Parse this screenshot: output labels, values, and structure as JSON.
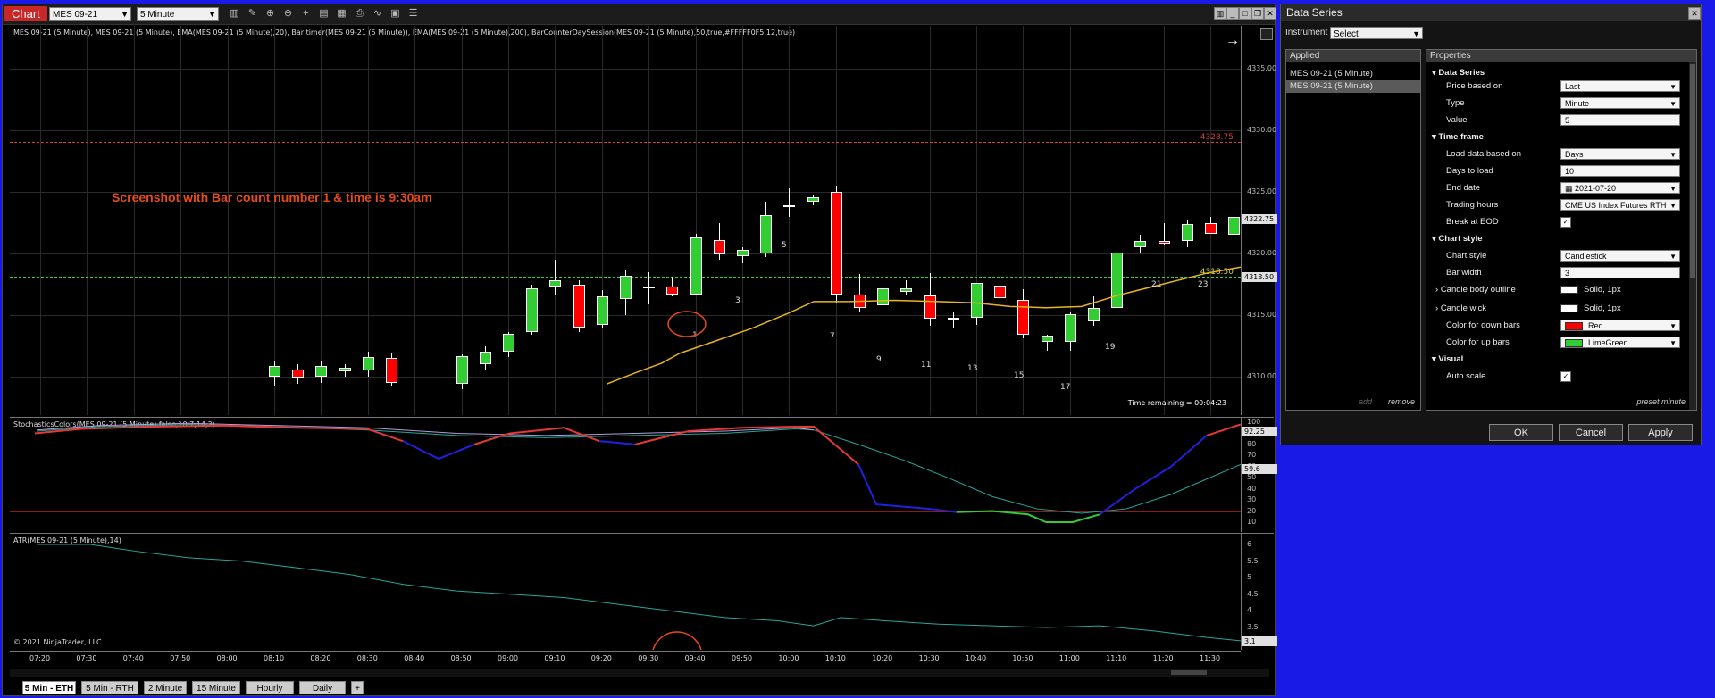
{
  "chart": {
    "tab": "Chart",
    "instrument": "MES 09-21",
    "interval": "5 Minute",
    "indicators_label": "MES 09-21 (5 Minute), MES 09-21 (5 Minute), EMA(MES 09-21 (5 Minute),20), Bar timer(MES 09-21 (5 Minute)), EMA(MES 09-21 (5 Minute),200), BarCounterDaySession(MES 09-21 (5 Minute),50,true,#FFFFF0F5,12,true)",
    "annotation": "Screenshot with Bar count number 1 & time is 9:30am",
    "time_remaining": "Time remaining = 00:04:23",
    "price_ticks": [
      "4335.00",
      "4330.00",
      "4325.00",
      "4320.00",
      "4315.00",
      "4310.00"
    ],
    "line_red_label": "4328.75",
    "line_green_label": "4318.50",
    "last_price_tag": "4322.75",
    "green_line_tag": "4318.50",
    "bar_numbers": [
      "1",
      "3",
      "5",
      "7",
      "9",
      "11",
      "13",
      "15",
      "17",
      "19",
      "21",
      "23"
    ],
    "copyright": "© 2021 NinjaTrader, LLC",
    "time_axis": [
      "07:20",
      "07:30",
      "07:40",
      "07:50",
      "08:00",
      "08:10",
      "08:20",
      "08:30",
      "08:40",
      "08:50",
      "09:00",
      "09:10",
      "09:20",
      "09:30",
      "09:40",
      "09:50",
      "10:00",
      "10:10",
      "10:20",
      "10:30",
      "10:40",
      "10:50",
      "11:00",
      "11:10",
      "11:20",
      "11:30"
    ]
  },
  "stochastics": {
    "label": "StochasticsColors(MES 09-21 (5 Minute),false,10,7,14,3)",
    "ticks": [
      "100",
      "90",
      "80",
      "70",
      "60",
      "50",
      "40",
      "30",
      "20",
      "10"
    ],
    "tag": "92.25",
    "tag2": "59.6"
  },
  "atr": {
    "label": "ATR(MES 09-21 (5 Minute),14)",
    "ticks": [
      "6",
      "5.5",
      "5",
      "4.5",
      "4",
      "3.5"
    ],
    "tag": "3.1"
  },
  "bottom_tabs": [
    "5 Min - ETH",
    "5 Min - RTH",
    "2 Minute",
    "15 Minute",
    "Hourly",
    "Daily",
    "+"
  ],
  "dialog": {
    "title": "Data Series",
    "instrument_label": "Instrument",
    "instrument_value": "Select",
    "applied_header": "Applied",
    "applied_items": [
      "MES 09-21 (5 Minute)",
      "MES 09-21 (5 Minute)"
    ],
    "add_label": "add",
    "remove_label": "remove",
    "properties_header": "Properties",
    "sections": {
      "data_series": "Data Series",
      "time_frame": "Time frame",
      "chart_style": "Chart style",
      "visual": "Visual"
    },
    "props": {
      "price_based_on": {
        "label": "Price based on",
        "value": "Last"
      },
      "type": {
        "label": "Type",
        "value": "Minute"
      },
      "value": {
        "label": "Value",
        "value": "5"
      },
      "load_data_based_on": {
        "label": "Load data based on",
        "value": "Days"
      },
      "days_to_load": {
        "label": "Days to load",
        "value": "10"
      },
      "end_date": {
        "label": "End date",
        "value": "2021-07-20"
      },
      "trading_hours": {
        "label": "Trading hours",
        "value": "CME US Index Futures RTH"
      },
      "break_at_eod": {
        "label": "Break at EOD",
        "value": "✓"
      },
      "chart_style": {
        "label": "Chart style",
        "value": "Candlestick"
      },
      "bar_width": {
        "label": "Bar width",
        "value": "3"
      },
      "candle_body_outline": {
        "label": "Candle body outline",
        "value": "Solid, 1px"
      },
      "candle_wick": {
        "label": "Candle wick",
        "value": "Solid, 1px"
      },
      "color_down": {
        "label": "Color for down bars",
        "value": "Red"
      },
      "color_up": {
        "label": "Color for up bars",
        "value": "LimeGreen"
      },
      "auto_scale": {
        "label": "Auto scale",
        "value": "✓"
      }
    },
    "preset_label": "preset minute",
    "ok": "OK",
    "cancel": "Cancel",
    "apply": "Apply"
  },
  "colors": {
    "up": "#32cd32",
    "down": "#ff0000",
    "ema": "#e6b422",
    "desktop": "#1a1ae6"
  }
}
